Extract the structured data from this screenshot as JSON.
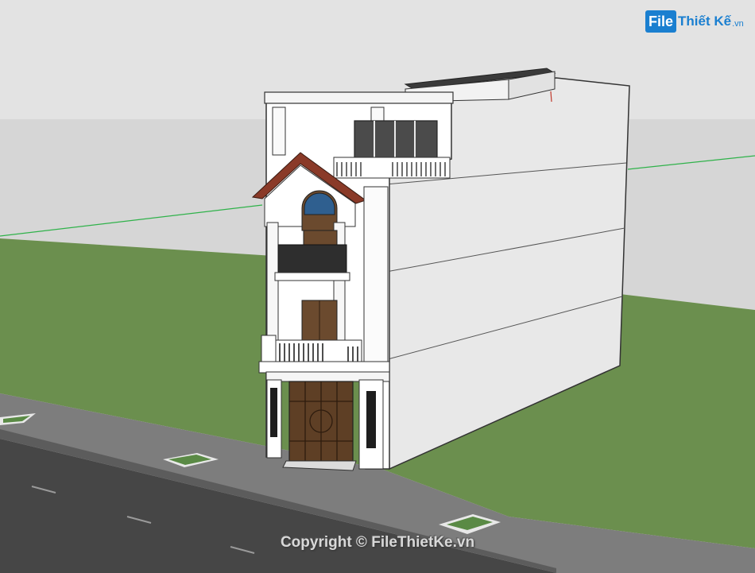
{
  "image": {
    "subject": "3D SketchUp model of a narrow multi-storey townhouse beside a road",
    "colors": {
      "sky": "#dedede",
      "lawn": "#6b8f4e",
      "road": "#4a4a4a",
      "sidewalk": "#7a7a7a",
      "facade": "#ffffff",
      "side_wall": "#e6e6e6",
      "roof_tile": "#8a3a28",
      "door": "#6b4a2e",
      "axis_green": "#2fb24a",
      "axis_red": "#c0392b"
    }
  },
  "watermark": {
    "logo_box": "File",
    "logo_rest": "Thiết Kế",
    "logo_tld": ".vn",
    "copyright": "Copyright © FileThietKe.vn"
  }
}
